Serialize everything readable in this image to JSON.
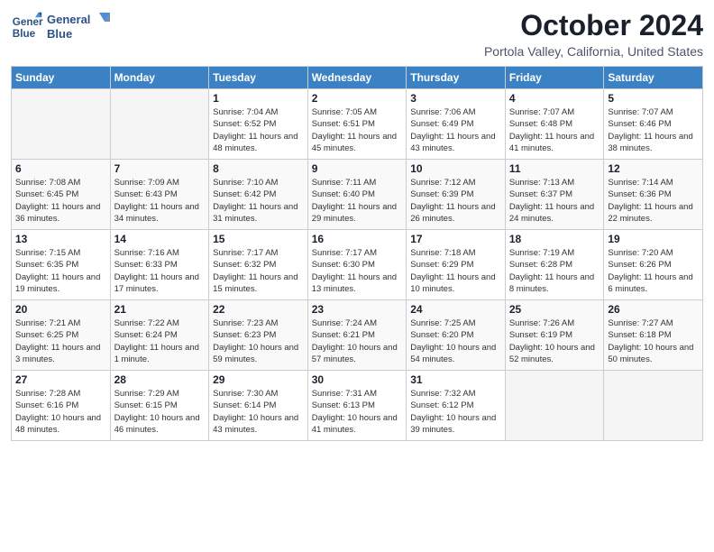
{
  "logo": {
    "line1": "General",
    "line2": "Blue"
  },
  "title": "October 2024",
  "location": "Portola Valley, California, United States",
  "headers": [
    "Sunday",
    "Monday",
    "Tuesday",
    "Wednesday",
    "Thursday",
    "Friday",
    "Saturday"
  ],
  "weeks": [
    [
      {
        "day": "",
        "info": ""
      },
      {
        "day": "",
        "info": ""
      },
      {
        "day": "1",
        "info": "Sunrise: 7:04 AM\nSunset: 6:52 PM\nDaylight: 11 hours and 48 minutes."
      },
      {
        "day": "2",
        "info": "Sunrise: 7:05 AM\nSunset: 6:51 PM\nDaylight: 11 hours and 45 minutes."
      },
      {
        "day": "3",
        "info": "Sunrise: 7:06 AM\nSunset: 6:49 PM\nDaylight: 11 hours and 43 minutes."
      },
      {
        "day": "4",
        "info": "Sunrise: 7:07 AM\nSunset: 6:48 PM\nDaylight: 11 hours and 41 minutes."
      },
      {
        "day": "5",
        "info": "Sunrise: 7:07 AM\nSunset: 6:46 PM\nDaylight: 11 hours and 38 minutes."
      }
    ],
    [
      {
        "day": "6",
        "info": "Sunrise: 7:08 AM\nSunset: 6:45 PM\nDaylight: 11 hours and 36 minutes."
      },
      {
        "day": "7",
        "info": "Sunrise: 7:09 AM\nSunset: 6:43 PM\nDaylight: 11 hours and 34 minutes."
      },
      {
        "day": "8",
        "info": "Sunrise: 7:10 AM\nSunset: 6:42 PM\nDaylight: 11 hours and 31 minutes."
      },
      {
        "day": "9",
        "info": "Sunrise: 7:11 AM\nSunset: 6:40 PM\nDaylight: 11 hours and 29 minutes."
      },
      {
        "day": "10",
        "info": "Sunrise: 7:12 AM\nSunset: 6:39 PM\nDaylight: 11 hours and 26 minutes."
      },
      {
        "day": "11",
        "info": "Sunrise: 7:13 AM\nSunset: 6:37 PM\nDaylight: 11 hours and 24 minutes."
      },
      {
        "day": "12",
        "info": "Sunrise: 7:14 AM\nSunset: 6:36 PM\nDaylight: 11 hours and 22 minutes."
      }
    ],
    [
      {
        "day": "13",
        "info": "Sunrise: 7:15 AM\nSunset: 6:35 PM\nDaylight: 11 hours and 19 minutes."
      },
      {
        "day": "14",
        "info": "Sunrise: 7:16 AM\nSunset: 6:33 PM\nDaylight: 11 hours and 17 minutes."
      },
      {
        "day": "15",
        "info": "Sunrise: 7:17 AM\nSunset: 6:32 PM\nDaylight: 11 hours and 15 minutes."
      },
      {
        "day": "16",
        "info": "Sunrise: 7:17 AM\nSunset: 6:30 PM\nDaylight: 11 hours and 13 minutes."
      },
      {
        "day": "17",
        "info": "Sunrise: 7:18 AM\nSunset: 6:29 PM\nDaylight: 11 hours and 10 minutes."
      },
      {
        "day": "18",
        "info": "Sunrise: 7:19 AM\nSunset: 6:28 PM\nDaylight: 11 hours and 8 minutes."
      },
      {
        "day": "19",
        "info": "Sunrise: 7:20 AM\nSunset: 6:26 PM\nDaylight: 11 hours and 6 minutes."
      }
    ],
    [
      {
        "day": "20",
        "info": "Sunrise: 7:21 AM\nSunset: 6:25 PM\nDaylight: 11 hours and 3 minutes."
      },
      {
        "day": "21",
        "info": "Sunrise: 7:22 AM\nSunset: 6:24 PM\nDaylight: 11 hours and 1 minute."
      },
      {
        "day": "22",
        "info": "Sunrise: 7:23 AM\nSunset: 6:23 PM\nDaylight: 10 hours and 59 minutes."
      },
      {
        "day": "23",
        "info": "Sunrise: 7:24 AM\nSunset: 6:21 PM\nDaylight: 10 hours and 57 minutes."
      },
      {
        "day": "24",
        "info": "Sunrise: 7:25 AM\nSunset: 6:20 PM\nDaylight: 10 hours and 54 minutes."
      },
      {
        "day": "25",
        "info": "Sunrise: 7:26 AM\nSunset: 6:19 PM\nDaylight: 10 hours and 52 minutes."
      },
      {
        "day": "26",
        "info": "Sunrise: 7:27 AM\nSunset: 6:18 PM\nDaylight: 10 hours and 50 minutes."
      }
    ],
    [
      {
        "day": "27",
        "info": "Sunrise: 7:28 AM\nSunset: 6:16 PM\nDaylight: 10 hours and 48 minutes."
      },
      {
        "day": "28",
        "info": "Sunrise: 7:29 AM\nSunset: 6:15 PM\nDaylight: 10 hours and 46 minutes."
      },
      {
        "day": "29",
        "info": "Sunrise: 7:30 AM\nSunset: 6:14 PM\nDaylight: 10 hours and 43 minutes."
      },
      {
        "day": "30",
        "info": "Sunrise: 7:31 AM\nSunset: 6:13 PM\nDaylight: 10 hours and 41 minutes."
      },
      {
        "day": "31",
        "info": "Sunrise: 7:32 AM\nSunset: 6:12 PM\nDaylight: 10 hours and 39 minutes."
      },
      {
        "day": "",
        "info": ""
      },
      {
        "day": "",
        "info": ""
      }
    ]
  ]
}
